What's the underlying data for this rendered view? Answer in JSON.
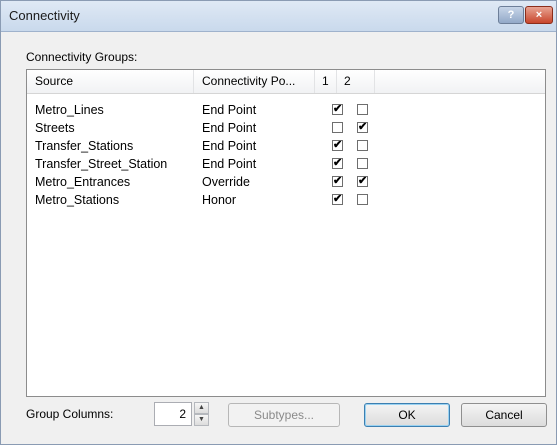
{
  "window": {
    "title": "Connectivity",
    "help_label": "?",
    "close_label": "×"
  },
  "groups_label": "Connectivity Groups:",
  "table": {
    "columns": [
      "Source",
      "Connectivity Po...",
      "1",
      "2"
    ],
    "rows": [
      {
        "source": "Metro_Lines",
        "policy": "End Point",
        "c1": true,
        "c2": false
      },
      {
        "source": "Streets",
        "policy": "End Point",
        "c1": false,
        "c2": true
      },
      {
        "source": "Transfer_Stations",
        "policy": "End Point",
        "c1": true,
        "c2": false
      },
      {
        "source": "Transfer_Street_Station",
        "policy": "End Point",
        "c1": true,
        "c2": false
      },
      {
        "source": "Metro_Entrances",
        "policy": "Override",
        "c1": true,
        "c2": true
      },
      {
        "source": "Metro_Stations",
        "policy": "Honor",
        "c1": true,
        "c2": false
      }
    ]
  },
  "footer": {
    "group_columns_label": "Group Columns:",
    "group_columns_value": "2",
    "subtypes_label": "Subtypes...",
    "ok_label": "OK",
    "cancel_label": "Cancel"
  },
  "icons": {
    "check": "✔",
    "spin_up": "▲",
    "spin_down": "▼"
  }
}
